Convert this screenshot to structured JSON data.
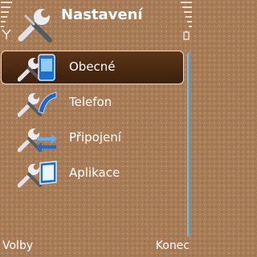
{
  "header": {
    "title": "Nastavení",
    "icon": "tools-wrench-screwdriver-icon"
  },
  "menu": {
    "items": [
      {
        "label": "Obecné",
        "icon": "phone-general-icon",
        "selected": true
      },
      {
        "label": "Telefon",
        "icon": "phone-handset-icon",
        "selected": false
      },
      {
        "label": "Připojení",
        "icon": "connection-arrows-icon",
        "selected": false
      },
      {
        "label": "Aplikace",
        "icon": "application-window-icon",
        "selected": false
      }
    ]
  },
  "softkeys": {
    "left": "Volby",
    "right": "Konec"
  },
  "colors": {
    "background": "#a97c58",
    "highlight": "#4a2812",
    "scrollbar": "#7aa6b8"
  }
}
